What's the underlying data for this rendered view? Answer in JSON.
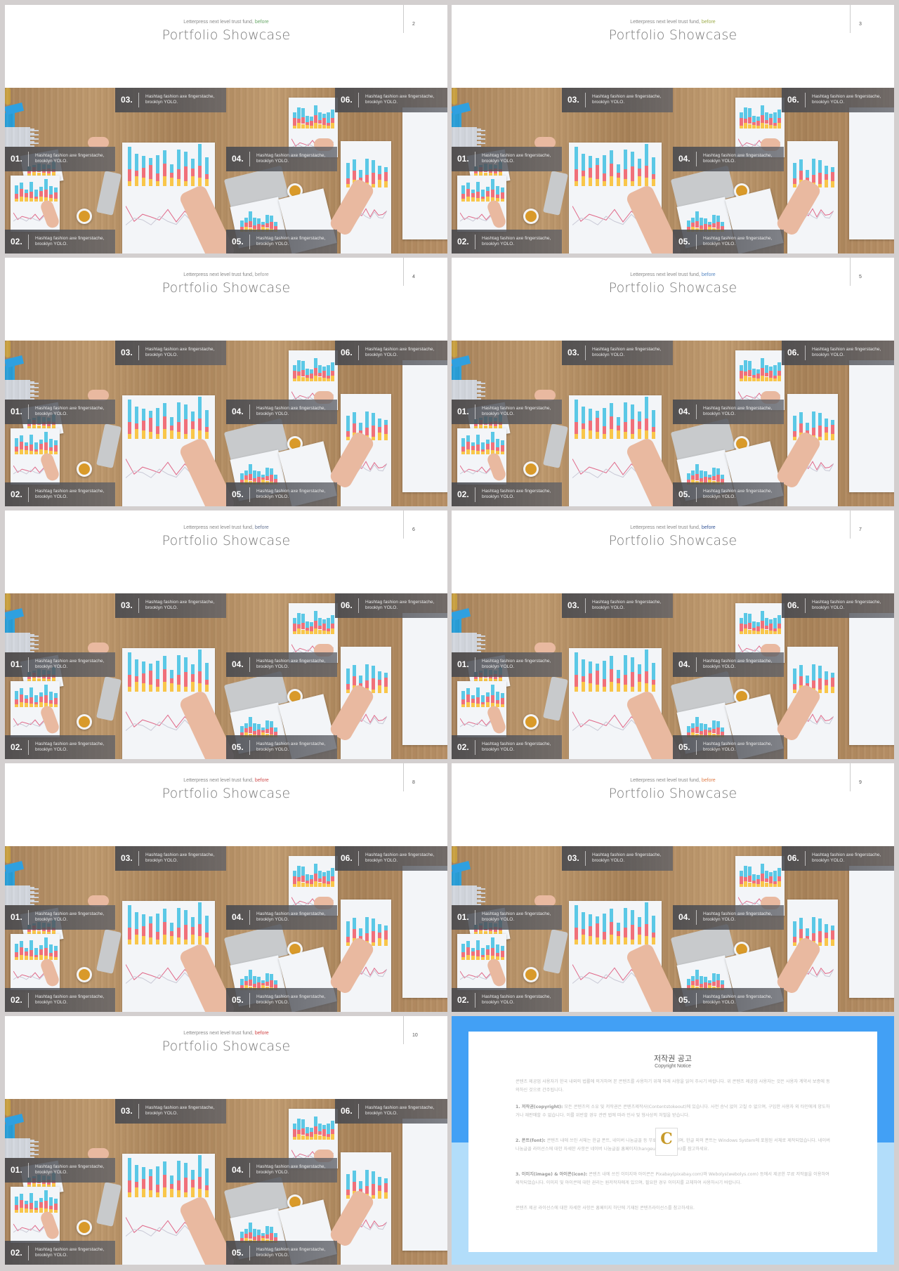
{
  "common": {
    "subtitle": "Letterpress next level trust fund, ",
    "subtitle_accent": "before",
    "title": "Portfolio Showcase",
    "items": [
      {
        "num": "01.",
        "line1": "Hashtag fashion axe fingerstache,",
        "line2": "brooklyn YOLO."
      },
      {
        "num": "02.",
        "line1": "Hashtag fashion axe fingerstache,",
        "line2": "brooklyn YOLO."
      },
      {
        "num": "03.",
        "line1": "Hashtag fashion axe fingerstache,",
        "line2": "brooklyn YOLO."
      },
      {
        "num": "04.",
        "line1": "Hashtag fashion axe fingerstache,",
        "line2": "brooklyn YOLO."
      },
      {
        "num": "05.",
        "line1": "Hashtag fashion axe fingerstache,",
        "line2": "brooklyn YOLO."
      },
      {
        "num": "06.",
        "line1": "Hashtag fashion axe fingerstache,",
        "line2": "brooklyn YOLO."
      }
    ]
  },
  "slides": [
    {
      "page": "2",
      "accent_color": "#6aa86a"
    },
    {
      "page": "3",
      "accent_color": "#9fae4e"
    },
    {
      "page": "4",
      "accent_color": "#9a9a9a"
    },
    {
      "page": "5",
      "accent_color": "#5a8ac4"
    },
    {
      "page": "6",
      "accent_color": "#6a7896"
    },
    {
      "page": "7",
      "accent_color": "#3a5a9a"
    },
    {
      "page": "8",
      "accent_color": "#d05050"
    },
    {
      "page": "9",
      "accent_color": "#e0804e"
    },
    {
      "page": "10",
      "accent_color": "#d04545"
    }
  ],
  "copyright": {
    "title": "저작권 공고",
    "subtitle": "Copyright Notice",
    "intro": "콘텐츠 제공업 사용자가 한국 내외의 법률에 의거하여 본 콘텐츠를 사용하기 위해 아래 사항을 읽어 주시기 바랍니다. 위 콘텐츠 제공업 사용자는 것은 사용자 계약서 보증에 동의하신 것으로 간주됩니다.",
    "p1_label": "1. 저작권(copyright):",
    "p1": "모든 콘텐츠의 소유 및 저작권은 콘텐츠제작사(Contentstokeout)에 있습니다. 사전 승낙 없이 고칠 수 없으며, 구입한 사용자 외 타인에게 양도하거나 재판매할 수 없습니다. 이를 위반할 경우 관련 법에 따라 민사 및 형사상의 처벌을 받습니다.",
    "p2_label": "2. 폰트(font):",
    "p2": "콘텐츠 내에 쓰인 서체는 한글 폰트, 네이버 나눔글꼴 등 무료 배포 서체이며, 한글 외의 폰트는 Windows System에 포함된 서체로 제작되었습니다. 네이버 나눔글꼴 라이선스에 대한 자세한 사항은 네이버 나눔글꼴 홈페이지(hangeul.naver.com)를 참고하세요.",
    "p3_label": "3. 이미지(image) & 아이콘(icon):",
    "p3": "콘텐츠 내에 쓰인 이미지와 아이콘은 Pixabay(pixabay.com)와 Webolys(webolys.com) 등에서 제공한 무료 저작물을 이용하여 제작되었습니다. 이미지 및 아이콘에 대한 권리는 원저작자에게 있으며, 필요한 경우 이미지를 교체하여 사용하시기 바랍니다.",
    "outro": "콘텐츠 제공 라이선스에 대한 자세한 사항은 홈페이지 하단에 기재된 콘텐츠라이선스를 참고하세요.",
    "logo_text": "C",
    "top_color": "#42a0f5",
    "bottom_color": "#b2ddfa"
  },
  "chart_colors": [
    "#5bc8e6",
    "#f0707a",
    "#f9c64a"
  ]
}
